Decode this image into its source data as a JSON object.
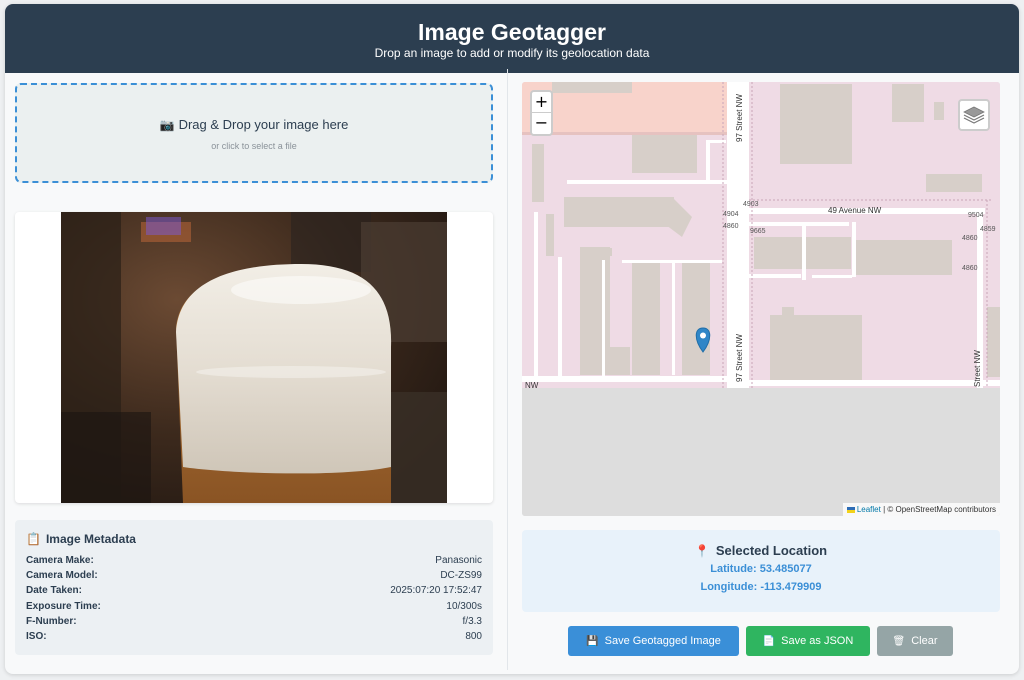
{
  "header": {
    "title": "Image Geotagger",
    "subtitle": "Drop an image to add or modify its geolocation data"
  },
  "dropzone": {
    "main_text": "Drag & Drop your image here",
    "sub_text": "or click to select a file"
  },
  "metadata": {
    "title": "Image Metadata",
    "rows": [
      {
        "label": "Camera Make:",
        "value": "Panasonic"
      },
      {
        "label": "Camera Model:",
        "value": "DC-ZS99"
      },
      {
        "label": "Date Taken:",
        "value": "2025:07:20 17:52:47"
      },
      {
        "label": "Exposure Time:",
        "value": "10/300s"
      },
      {
        "label": "F-Number:",
        "value": "f/3.3"
      },
      {
        "label": "ISO:",
        "value": "800"
      }
    ]
  },
  "map": {
    "streets": {
      "s1": "97 Street NW",
      "s2": "97 Street NW",
      "s3": "49 Avenue NW",
      "s4": "Street NW",
      "s5": "NW"
    },
    "addresses": {
      "a1": "4903",
      "a2": "4904",
      "a3": "4860",
      "a4": "9665",
      "a5": "9504",
      "a6": "4859",
      "a7": "4860",
      "a8": "4860"
    },
    "zoom_in": "+",
    "zoom_out": "−",
    "attribution_link": "Leaflet",
    "attribution_text": " | © OpenStreetMap contributors"
  },
  "selected": {
    "title": "Selected Location",
    "latitude": "Latitude: 53.485077",
    "longitude": "Longitude: -113.479909"
  },
  "buttons": {
    "save_image": "Save Geotagged Image",
    "save_json": "Save as JSON",
    "clear": "Clear"
  }
}
